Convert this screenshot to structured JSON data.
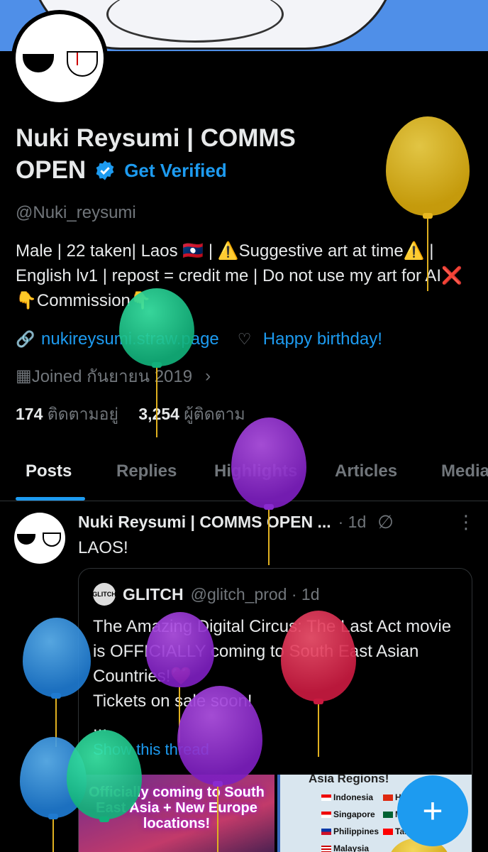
{
  "profile": {
    "name_line1": "Nuki Reysumi | COMMS",
    "name_line2": "OPEN",
    "get_verified": "Get Verified",
    "handle": "@Nuki_reysumi",
    "bio": "Male | 22 taken| Laos 🇱🇦 | ⚠️Suggestive art at time⚠️ | English lv1 | repost = credit me | Do not use my art for AI❌ 👇Commission👇",
    "website": "nukireysumi.straw.page",
    "birthday": "Happy birthday!",
    "joined": "Joined กันยายน 2019",
    "following_count": "174",
    "following_label": "ติดตามอยู่",
    "followers_count": "3,254",
    "followers_label": "ผู้ติดตาม"
  },
  "tabs": [
    "Posts",
    "Replies",
    "Highlights",
    "Articles",
    "Media"
  ],
  "post": {
    "author": "Nuki Reysumi | COMMS OPEN ...",
    "time": "· 1d",
    "text": "LAOS!",
    "quote": {
      "author": "GLITCH",
      "handle": "@glitch_prod · 1d",
      "avatar_text": "GLITCH",
      "body": "The Amazing Digital Circus: The Last Act movie is OFFICIALLY coming to South East Asian Countries!❤️\nTickets on sale soon!\n...",
      "show_thread": "Show this thread",
      "image1_text": "Officially coming to South East Asia + New Europe locations!",
      "image2_title": "Asia Regions!",
      "image2_countries": [
        "Indonesia",
        "Singapore",
        "Philippines",
        "Malaysia"
      ],
      "image2_countries2": [
        "Ho",
        "M",
        "Taiw"
      ]
    }
  },
  "fab_label": "+",
  "colors": {
    "accent": "#1d9bf0",
    "background": "#000000",
    "muted": "#71767b"
  }
}
